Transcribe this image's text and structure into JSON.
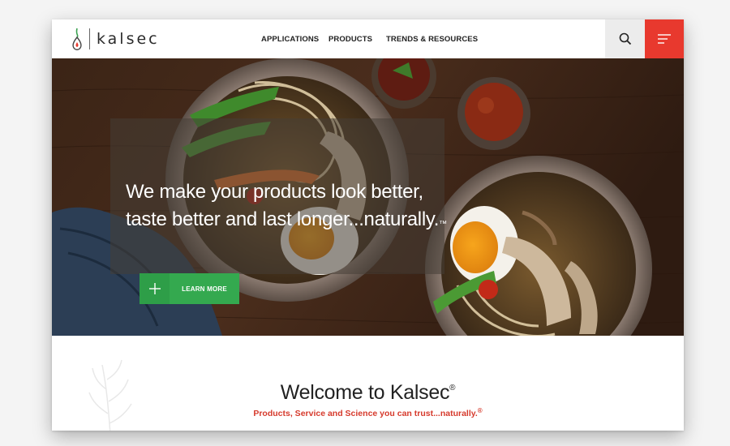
{
  "brand": {
    "name": "kalsec"
  },
  "nav": {
    "items": [
      "APPLICATIONS",
      "PRODUCTS",
      "TRENDS & RESOURCES"
    ]
  },
  "header": {
    "search_icon": "search-icon",
    "menu_icon": "hamburger-menu-icon"
  },
  "hero": {
    "headline_line1": "We make your products look better,",
    "headline_line2": "taste better and last longer...naturally.",
    "headline_mark": "™",
    "cta_label": "LEARN MORE",
    "cta_icon": "plus-icon"
  },
  "welcome": {
    "title": "Welcome to Kalsec",
    "title_mark": "®",
    "subtitle": "Products, Service and Science you can trust...naturally.",
    "subtitle_mark": "®"
  },
  "colors": {
    "accent_red": "#e8392e",
    "cta_green": "#34a94f",
    "subtitle_red": "#d63a2c"
  }
}
